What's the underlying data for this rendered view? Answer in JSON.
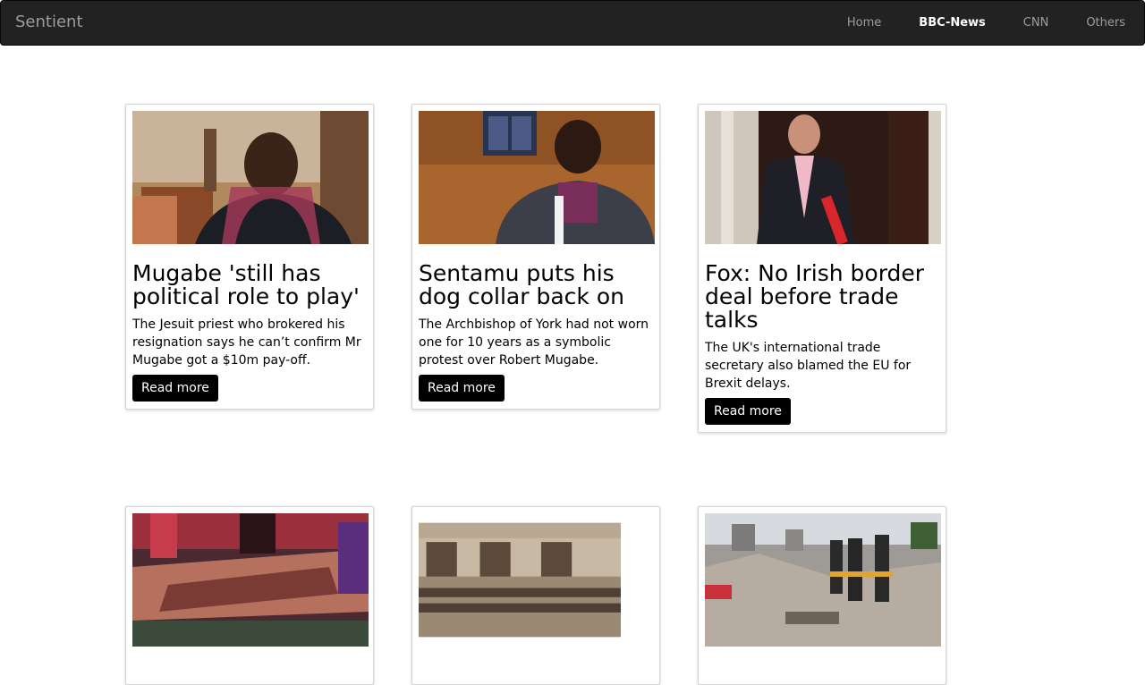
{
  "navbar": {
    "brand": "Sentient",
    "links": [
      "Home",
      "BBC-News",
      "CNN",
      "Others"
    ],
    "active": "BBC-News"
  },
  "articles": [
    {
      "title": "Mugabe 'still has political role to play'",
      "summary": "The Jesuit priest who brokered his resignation says he can’t confirm Mr Mugabe got a $10m pay-off.",
      "button": "Read more"
    },
    {
      "title": "Sentamu puts his dog collar back on",
      "summary": "The Archbishop of York had not worn one for 10 years as a symbolic protest over Robert Mugabe.",
      "button": "Read more"
    },
    {
      "title": "Fox: No Irish border deal before trade talks",
      "summary": "The UK's international trade secretary also blamed the EU for Brexit delays.",
      "button": "Read more"
    }
  ],
  "colors": {
    "navbar_bg": "#222222",
    "nav_text": "#9d9d9d",
    "nav_active": "#ffffff",
    "button_bg": "#000000"
  }
}
